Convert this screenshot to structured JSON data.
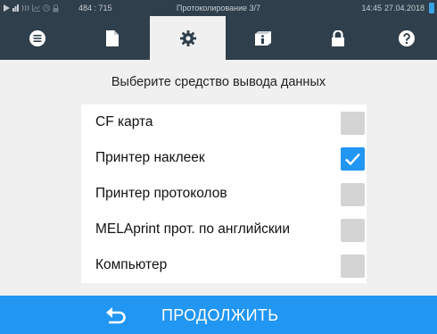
{
  "status": {
    "coords": "484 : 715",
    "center": "Протоколирование 3/7",
    "time": "14:45",
    "date": "27.04.2018",
    "icons": [
      "play-icon",
      "bars-icon",
      "wave-icon",
      "chart-icon",
      "clock-icon",
      "lock-small-icon"
    ]
  },
  "tabs": [
    {
      "name": "list-icon",
      "active": false
    },
    {
      "name": "document-icon",
      "active": false
    },
    {
      "name": "gear-icon",
      "active": true
    },
    {
      "name": "info-book-icon",
      "active": false
    },
    {
      "name": "lock-icon",
      "active": false
    },
    {
      "name": "help-icon",
      "active": false
    }
  ],
  "title": "Выберите средство вывода данных",
  "options": [
    {
      "label": "CF карта",
      "checked": false
    },
    {
      "label": "Принтер наклеек",
      "checked": true
    },
    {
      "label": "Принтер протоколов",
      "checked": false
    },
    {
      "label": "MELAprint прот. по английскии",
      "checked": false
    },
    {
      "label": "Компьютер",
      "checked": false
    }
  ],
  "action": {
    "label": "ПРОДОЛЖИТЬ",
    "icon": "back-arrow-icon"
  },
  "colors": {
    "bar": "#2f3f4b",
    "accent": "#2196f3",
    "unchecked": "#d4d4d4"
  }
}
